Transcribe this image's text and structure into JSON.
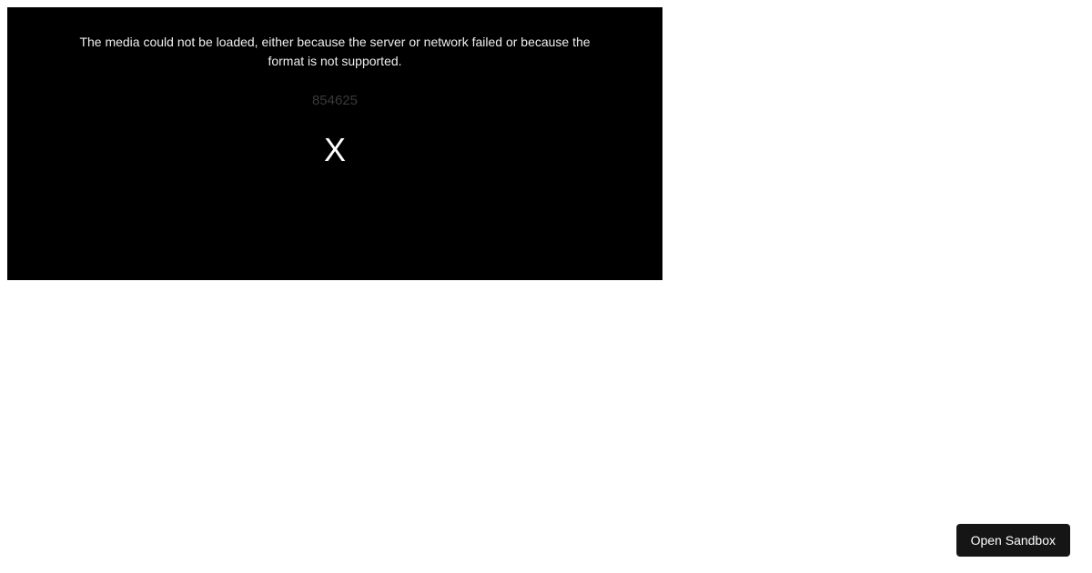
{
  "video": {
    "error_message": "The media could not be loaded, either because the server or network failed or because the format is not supported.",
    "error_code": "854625",
    "close_label": "X"
  },
  "sandbox": {
    "open_label": "Open Sandbox"
  }
}
